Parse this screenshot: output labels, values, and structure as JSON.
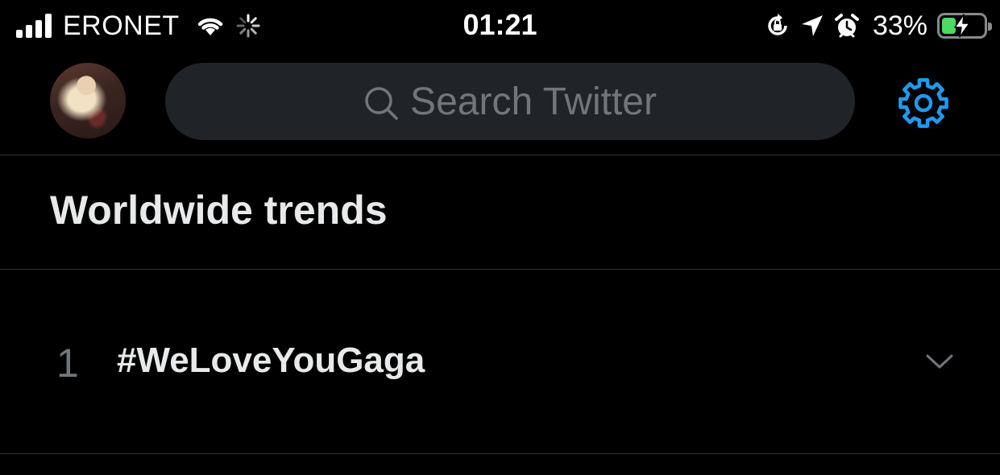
{
  "status_bar": {
    "carrier": "ERONET",
    "time": "01:21",
    "battery_percent": "33%",
    "battery_level": 0.33,
    "icons": [
      "signal-icon",
      "wifi-icon",
      "spinner-icon",
      "orientation-lock-icon",
      "location-icon",
      "alarm-icon",
      "battery-icon",
      "charging-bolt-icon"
    ]
  },
  "header": {
    "search_placeholder": "Search Twitter",
    "settings_icon": "gear-icon",
    "accent_color": "#1d9bf0"
  },
  "section": {
    "title": "Worldwide trends"
  },
  "trends": [
    {
      "rank": "1",
      "name": "#WeLoveYouGaga"
    }
  ]
}
